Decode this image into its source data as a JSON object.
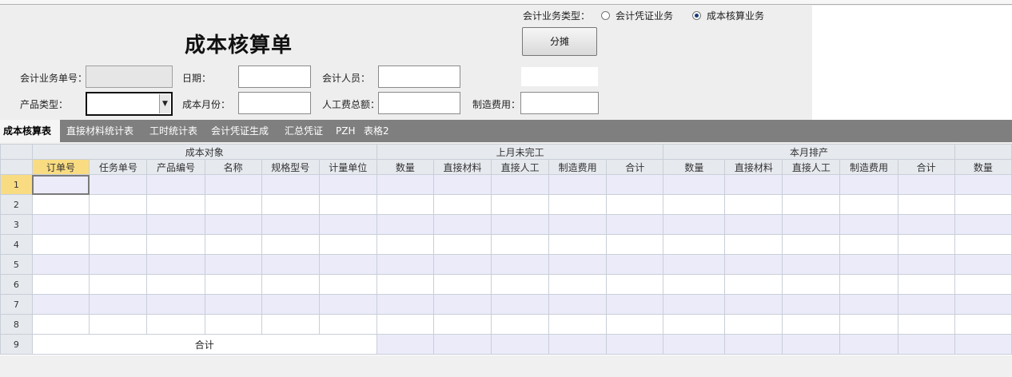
{
  "form": {
    "title": "成本核算单",
    "biz_type_label": "会计业务类型：",
    "radio_voucher": "会计凭证业务",
    "radio_cost": "成本核算业务",
    "allocate_button": "分摊",
    "labels": {
      "biz_no": "会计业务单号：",
      "date": "日期：",
      "accountant": "会计人员：",
      "product_type": "产品类型：",
      "cost_month": "成本月份：",
      "labor_total": "人工费总额：",
      "mfg_cost": "制造费用："
    },
    "values": {
      "biz_no": "",
      "date": "",
      "accountant": "",
      "product_type": "",
      "cost_month": "",
      "labor_total": "",
      "mfg_cost": ""
    }
  },
  "tabs": [
    "成本核算表",
    "直接材料统计表",
    "工时统计表",
    "会计凭证生成",
    "汇总凭证",
    "PZH",
    "表格2"
  ],
  "grid": {
    "groups": [
      "成本对象",
      "上月未完工",
      "本月排产"
    ],
    "columns": [
      "订单号",
      "任务单号",
      "产品编号",
      "名称",
      "规格型号",
      "计量单位",
      "数量",
      "直接材料",
      "直接人工",
      "制造费用",
      "合计",
      "数量",
      "直接材料",
      "直接人工",
      "制造费用",
      "合计",
      "数量"
    ],
    "row_numbers": [
      "1",
      "2",
      "3",
      "4",
      "5",
      "6",
      "7",
      "8",
      "9"
    ],
    "total_label": "合计"
  },
  "colors": {
    "tab_bar": "#7f7f7f",
    "selected_header": "#f9dc82",
    "alt_row": "#ebebfa"
  }
}
